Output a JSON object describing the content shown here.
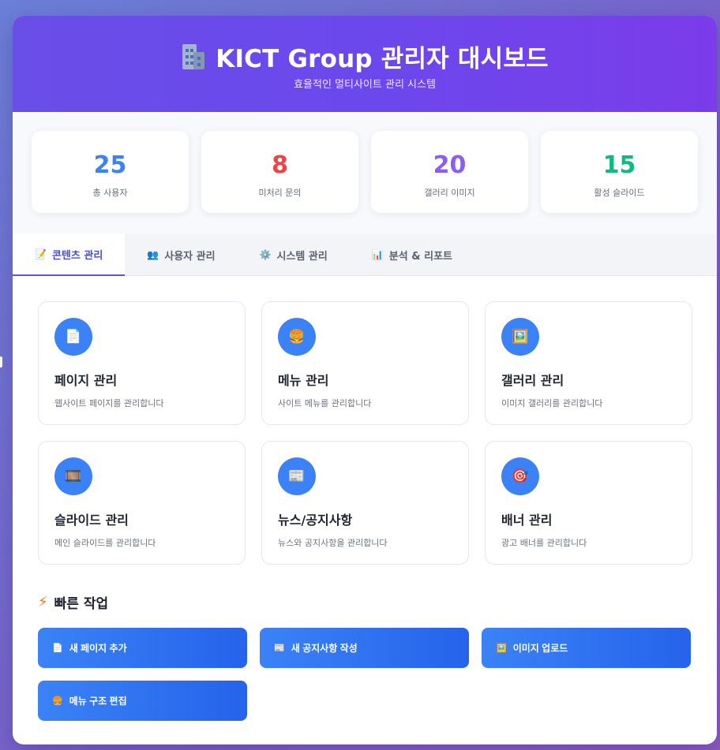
{
  "header": {
    "icon": "office-building-icon",
    "title": "KICT Group 관리자 대시보드",
    "subtitle": "효율적인 멀티사이트 관리 시스템"
  },
  "stats": [
    {
      "value": "25",
      "label": "총 사용자",
      "color": "#3b82f6"
    },
    {
      "value": "8",
      "label": "미처리 문의",
      "color": "#ef4444"
    },
    {
      "value": "20",
      "label": "갤러리 이미지",
      "color": "#8b5cf6"
    },
    {
      "value": "15",
      "label": "활성 슬라이드",
      "color": "#10b981"
    }
  ],
  "tabs": [
    {
      "icon": "memo-icon",
      "glyph": "📝",
      "label": "콘텐츠 관리",
      "active": true
    },
    {
      "icon": "users-icon",
      "glyph": "👥",
      "label": "사용자 관리",
      "active": false
    },
    {
      "icon": "gear-icon",
      "glyph": "⚙️",
      "label": "시스템 관리",
      "active": false
    },
    {
      "icon": "chart-icon",
      "glyph": "📊",
      "label": "분석 & 리포트",
      "active": false
    }
  ],
  "cards": [
    {
      "icon": "page-icon",
      "glyph": "📄",
      "title": "페이지 관리",
      "desc": "웹사이트 페이지를 관리합니다"
    },
    {
      "icon": "hamburger-icon",
      "glyph": "🍔",
      "title": "메뉴 관리",
      "desc": "사이트 메뉴를 관리합니다"
    },
    {
      "icon": "picture-icon",
      "glyph": "🖼️",
      "title": "갤러리 관리",
      "desc": "이미지 갤러리를 관리합니다"
    },
    {
      "icon": "film-icon",
      "glyph": "🎞️",
      "title": "슬라이드 관리",
      "desc": "메인 슬라이드를 관리합니다"
    },
    {
      "icon": "newspaper-icon",
      "glyph": "📰",
      "title": "뉴스/공지사항",
      "desc": "뉴스와 공지사항을 관리합니다"
    },
    {
      "icon": "target-icon",
      "glyph": "🎯",
      "title": "배너 관리",
      "desc": "광고 배너를 관리합니다"
    }
  ],
  "quick": {
    "icon": "lightning-icon",
    "title": "빠른 작업",
    "buttons": [
      {
        "icon": "page-icon",
        "glyph": "📄",
        "label": "새 페이지 추가"
      },
      {
        "icon": "newspaper-icon",
        "glyph": "📰",
        "label": "새 공지사항 작성"
      },
      {
        "icon": "picture-icon",
        "glyph": "🖼️",
        "label": "이미지 업로드"
      },
      {
        "icon": "hamburger-icon",
        "glyph": "🍔",
        "label": "메뉴 구조 편집"
      }
    ]
  }
}
